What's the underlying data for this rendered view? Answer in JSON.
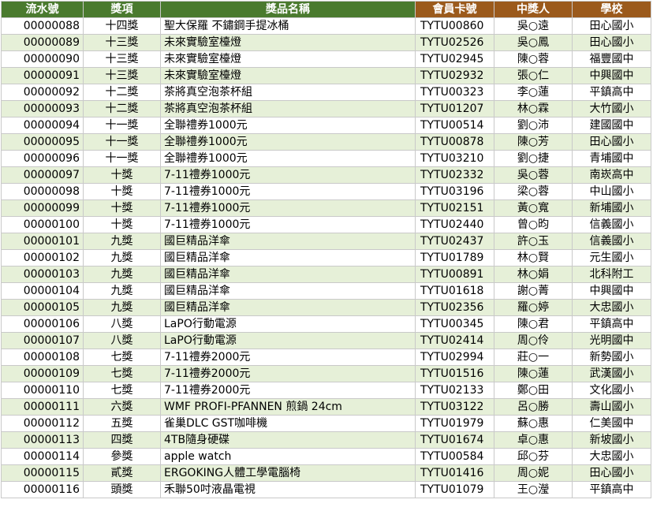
{
  "headers": [
    "流水號",
    "獎項",
    "獎品名稱",
    "會員卡號",
    "中獎人",
    "學校"
  ],
  "colors": {
    "header_green": "#4a7a2e",
    "header_brown": "#9b5a1c",
    "row_alt": "#e6f0d8"
  },
  "rows": [
    [
      "00000088",
      "十四獎",
      "聖大保羅 不鏽鋼手提冰桶",
      "TYTU00860",
      "吳○遠",
      "田心國小"
    ],
    [
      "00000089",
      "十三獎",
      "未來實驗室檯燈",
      "TYTU02526",
      "吳○鳳",
      "田心國小"
    ],
    [
      "00000090",
      "十三獎",
      "未來實驗室檯燈",
      "TYTU02945",
      "陳○蓉",
      "福豐國中"
    ],
    [
      "00000091",
      "十三獎",
      "未來實驗室檯燈",
      "TYTU02932",
      "張○仁",
      "中興國中"
    ],
    [
      "00000092",
      "十二獎",
      "茶將真空泡茶杯組",
      "TYTU00323",
      "李○蓮",
      "平鎮高中"
    ],
    [
      "00000093",
      "十二獎",
      "茶將真空泡茶杯組",
      "TYTU01207",
      "林○霖",
      "大竹國小"
    ],
    [
      "00000094",
      "十一獎",
      "全聯禮券1000元",
      "TYTU00514",
      "劉○沛",
      "建國國中"
    ],
    [
      "00000095",
      "十一獎",
      "全聯禮券1000元",
      "TYTU00878",
      "陳○芳",
      "田心國小"
    ],
    [
      "00000096",
      "十一獎",
      "全聯禮券1000元",
      "TYTU03210",
      "劉○捷",
      "青埔國中"
    ],
    [
      "00000097",
      "十獎",
      "7-11禮券1000元",
      "TYTU02332",
      "吳○蓉",
      "南崁高中"
    ],
    [
      "00000098",
      "十獎",
      "7-11禮券1000元",
      "TYTU03196",
      "梁○蓉",
      "中山國小"
    ],
    [
      "00000099",
      "十獎",
      "7-11禮券1000元",
      "TYTU02151",
      "黃○寬",
      "新埔國小"
    ],
    [
      "00000100",
      "十獎",
      "7-11禮券1000元",
      "TYTU02440",
      "曾○昀",
      "信義國小"
    ],
    [
      "00000101",
      "九獎",
      "國巨精品洋傘",
      "TYTU02437",
      "許○玉",
      "信義國小"
    ],
    [
      "00000102",
      "九獎",
      "國巨精品洋傘",
      "TYTU01789",
      "林○賢",
      "元生國小"
    ],
    [
      "00000103",
      "九獎",
      "國巨精品洋傘",
      "TYTU00891",
      "林○娟",
      "北科附工"
    ],
    [
      "00000104",
      "九獎",
      "國巨精品洋傘",
      "TYTU01618",
      "謝○菁",
      "中興國中"
    ],
    [
      "00000105",
      "九獎",
      "國巨精品洋傘",
      "TYTU02356",
      "羅○婷",
      "大忠國小"
    ],
    [
      "00000106",
      "八獎",
      "LaPO行動電源",
      "TYTU00345",
      "陳○君",
      "平鎮高中"
    ],
    [
      "00000107",
      "八獎",
      "LaPO行動電源",
      "TYTU02414",
      "周○伶",
      "光明國中"
    ],
    [
      "00000108",
      "七獎",
      "7-11禮券2000元",
      "TYTU02994",
      "莊○一",
      "新勢國小"
    ],
    [
      "00000109",
      "七獎",
      "7-11禮券2000元",
      "TYTU01516",
      "陳○蓮",
      "武漢國小"
    ],
    [
      "00000110",
      "七獎",
      "7-11禮券2000元",
      "TYTU02133",
      "鄭○田",
      "文化國小"
    ],
    [
      "00000111",
      "六獎",
      "WMF PROFI-PFANNEN 煎鍋 24cm",
      "TYTU03122",
      "呂○勝",
      "壽山國小"
    ],
    [
      "00000112",
      "五獎",
      "雀巢DLC GST咖啡機",
      "TYTU01979",
      "蘇○惠",
      "仁美國中"
    ],
    [
      "00000113",
      "四獎",
      "4TB隨身硬碟",
      "TYTU01674",
      "卓○惠",
      "新坡國小"
    ],
    [
      "00000114",
      "參獎",
      "apple watch",
      "TYTU00584",
      "邱○芬",
      "大忠國小"
    ],
    [
      "00000115",
      "貳獎",
      "ERGOKING人體工學電腦椅",
      "TYTU01416",
      "周○妮",
      "田心國小"
    ],
    [
      "00000116",
      "頭獎",
      "禾聯50吋液晶電視",
      "TYTU01079",
      "王○瀅",
      "平鎮高中"
    ]
  ]
}
